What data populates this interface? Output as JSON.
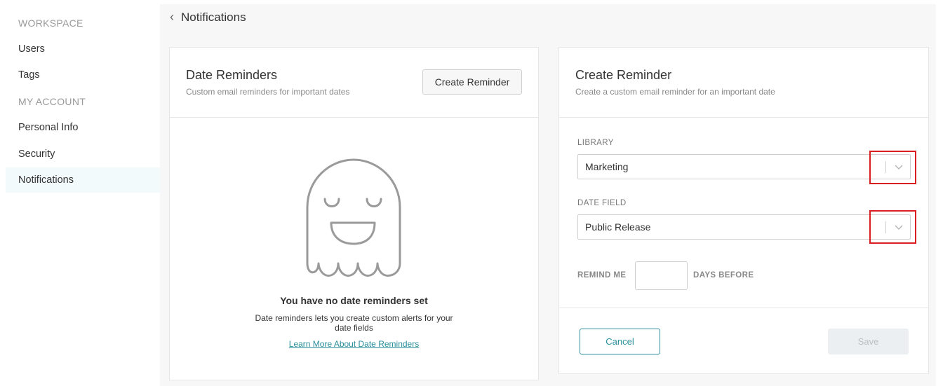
{
  "sidebar": {
    "sections": [
      {
        "label": "WORKSPACE"
      },
      {
        "label": "MY ACCOUNT"
      }
    ],
    "items": [
      {
        "label": "Users"
      },
      {
        "label": "Tags"
      },
      {
        "label": "Personal Info"
      },
      {
        "label": "Security"
      },
      {
        "label": "Notifications",
        "active": true
      }
    ]
  },
  "header": {
    "back_icon": "chevron-left-icon",
    "title": "Notifications"
  },
  "date_reminders": {
    "title": "Date Reminders",
    "subtitle": "Custom email reminders for important dates",
    "create_button": "Create Reminder",
    "empty_icon": "ghost-icon",
    "empty_title": "You have no date reminders set",
    "empty_description": "Date reminders lets you create custom alerts for your date fields",
    "learn_more_link": "Learn More About Date Reminders"
  },
  "create_reminder": {
    "title": "Create Reminder",
    "subtitle": "Create a custom email reminder for an important date",
    "library": {
      "label": "LIBRARY",
      "value": "Marketing"
    },
    "date_field": {
      "label": "DATE FIELD",
      "value": "Public Release"
    },
    "remind_prefix": "REMIND ME",
    "remind_value": "",
    "remind_suffix": "DAYS BEFORE",
    "cancel_button": "Cancel",
    "save_button": "Save"
  },
  "colors": {
    "accent": "#2a8f9b",
    "highlight": "#d81e1e",
    "active_nav_bg": "#f3fafb"
  }
}
